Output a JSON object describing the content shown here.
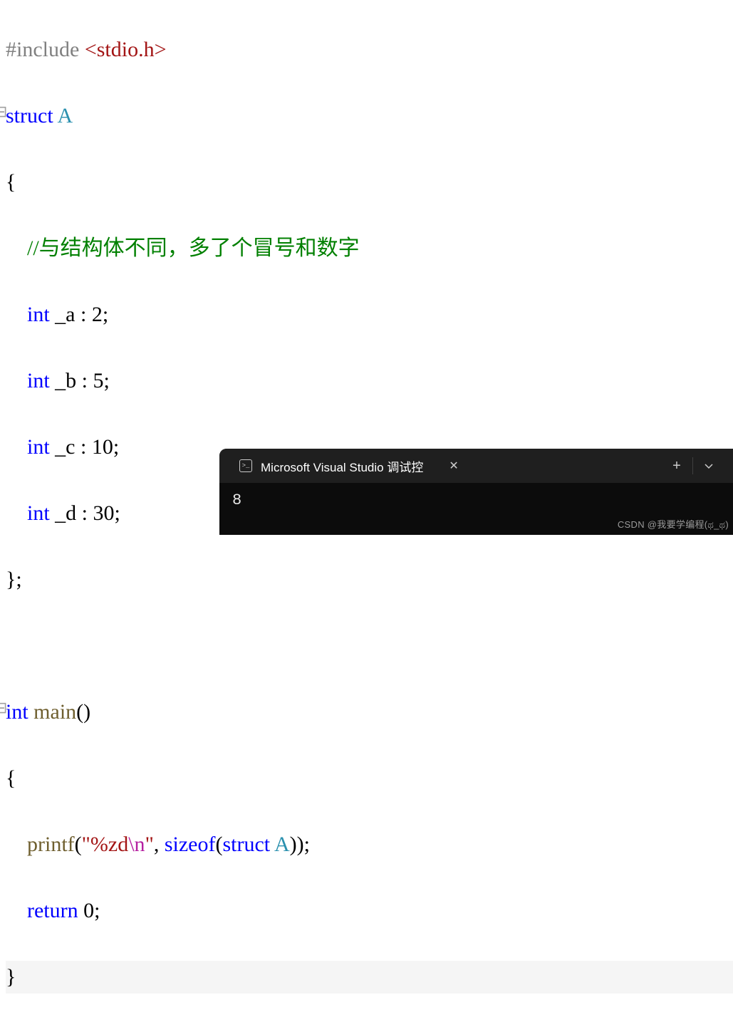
{
  "code": {
    "line1_include": "#include ",
    "line1_header": "<stdio.h>",
    "line2_struct": "struct",
    "line2_name": " A",
    "line3": "{",
    "line4_comment": "//与结构体不同，多了个冒号和数字",
    "line5_kw": "int",
    "line5_rest": " _a : 2;",
    "line6_kw": "int",
    "line6_rest": " _b : 5;",
    "line7_kw": "int",
    "line7_rest": " _c : 10;",
    "line8_kw": "int",
    "line8_rest": " _d : 30;",
    "line9": "};",
    "line11_kw": "int",
    "line11_func": " main",
    "line11_paren": "()",
    "line12": "{",
    "line13_func": "printf",
    "line13_paren_open": "(",
    "line13_str_open": "\"%zd",
    "line13_escape": "\\n",
    "line13_str_close": "\"",
    "line13_sep": ", ",
    "line13_sizeof": "sizeof",
    "line13_so_paren_open": "(",
    "line13_so_struct": "struct",
    "line13_so_type": " A",
    "line13_so_paren_close": ")",
    "line13_paren_close": ");",
    "line14_kw": "return",
    "line14_rest": " 0;",
    "line15": "}"
  },
  "terminal": {
    "icon_text": ">_",
    "title": "Microsoft Visual Studio 调试控",
    "close": "✕",
    "plus": "+",
    "chevron": "⌄",
    "output": "8"
  },
  "watermark": "CSDN @我要学编程(ಥ_ಥ)",
  "collapse_marker": "⊟"
}
